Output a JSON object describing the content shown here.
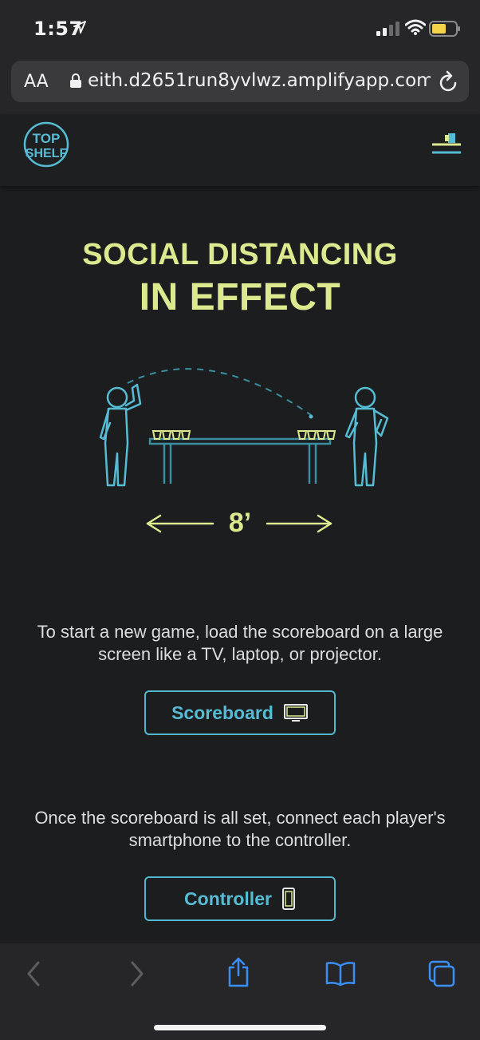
{
  "status_bar": {
    "time": "1:57",
    "icons": [
      "location-arrow-icon",
      "cellular-signal-icon",
      "wifi-icon",
      "battery-icon"
    ],
    "battery_color": "#f5d34a"
  },
  "browser": {
    "text_size_label": "AA",
    "url": "eith.d2651run8yvlwz.amplifyapp.com"
  },
  "site": {
    "logo_text_top": "TOP",
    "logo_text_bottom": "SHELF",
    "accent_color": "#56bcd4",
    "headline_color": "#dce98f"
  },
  "hero": {
    "headline_line1": "SOCIAL DISTANCING",
    "headline_line2": "IN EFFECT",
    "distance_label": "8’"
  },
  "steps": [
    {
      "description": "To start a new game, load the scoreboard on a large screen like a TV, laptop, or projector.",
      "button_label": "Scoreboard",
      "button_icon": "tv-icon"
    },
    {
      "description": "Once the scoreboard is all set, connect each player's smartphone to the controller.",
      "button_label": "Controller",
      "button_icon": "smartphone-icon"
    }
  ],
  "toolbar": {
    "icons": [
      "back-icon",
      "forward-icon",
      "share-icon",
      "bookmarks-icon",
      "tabs-icon"
    ]
  }
}
